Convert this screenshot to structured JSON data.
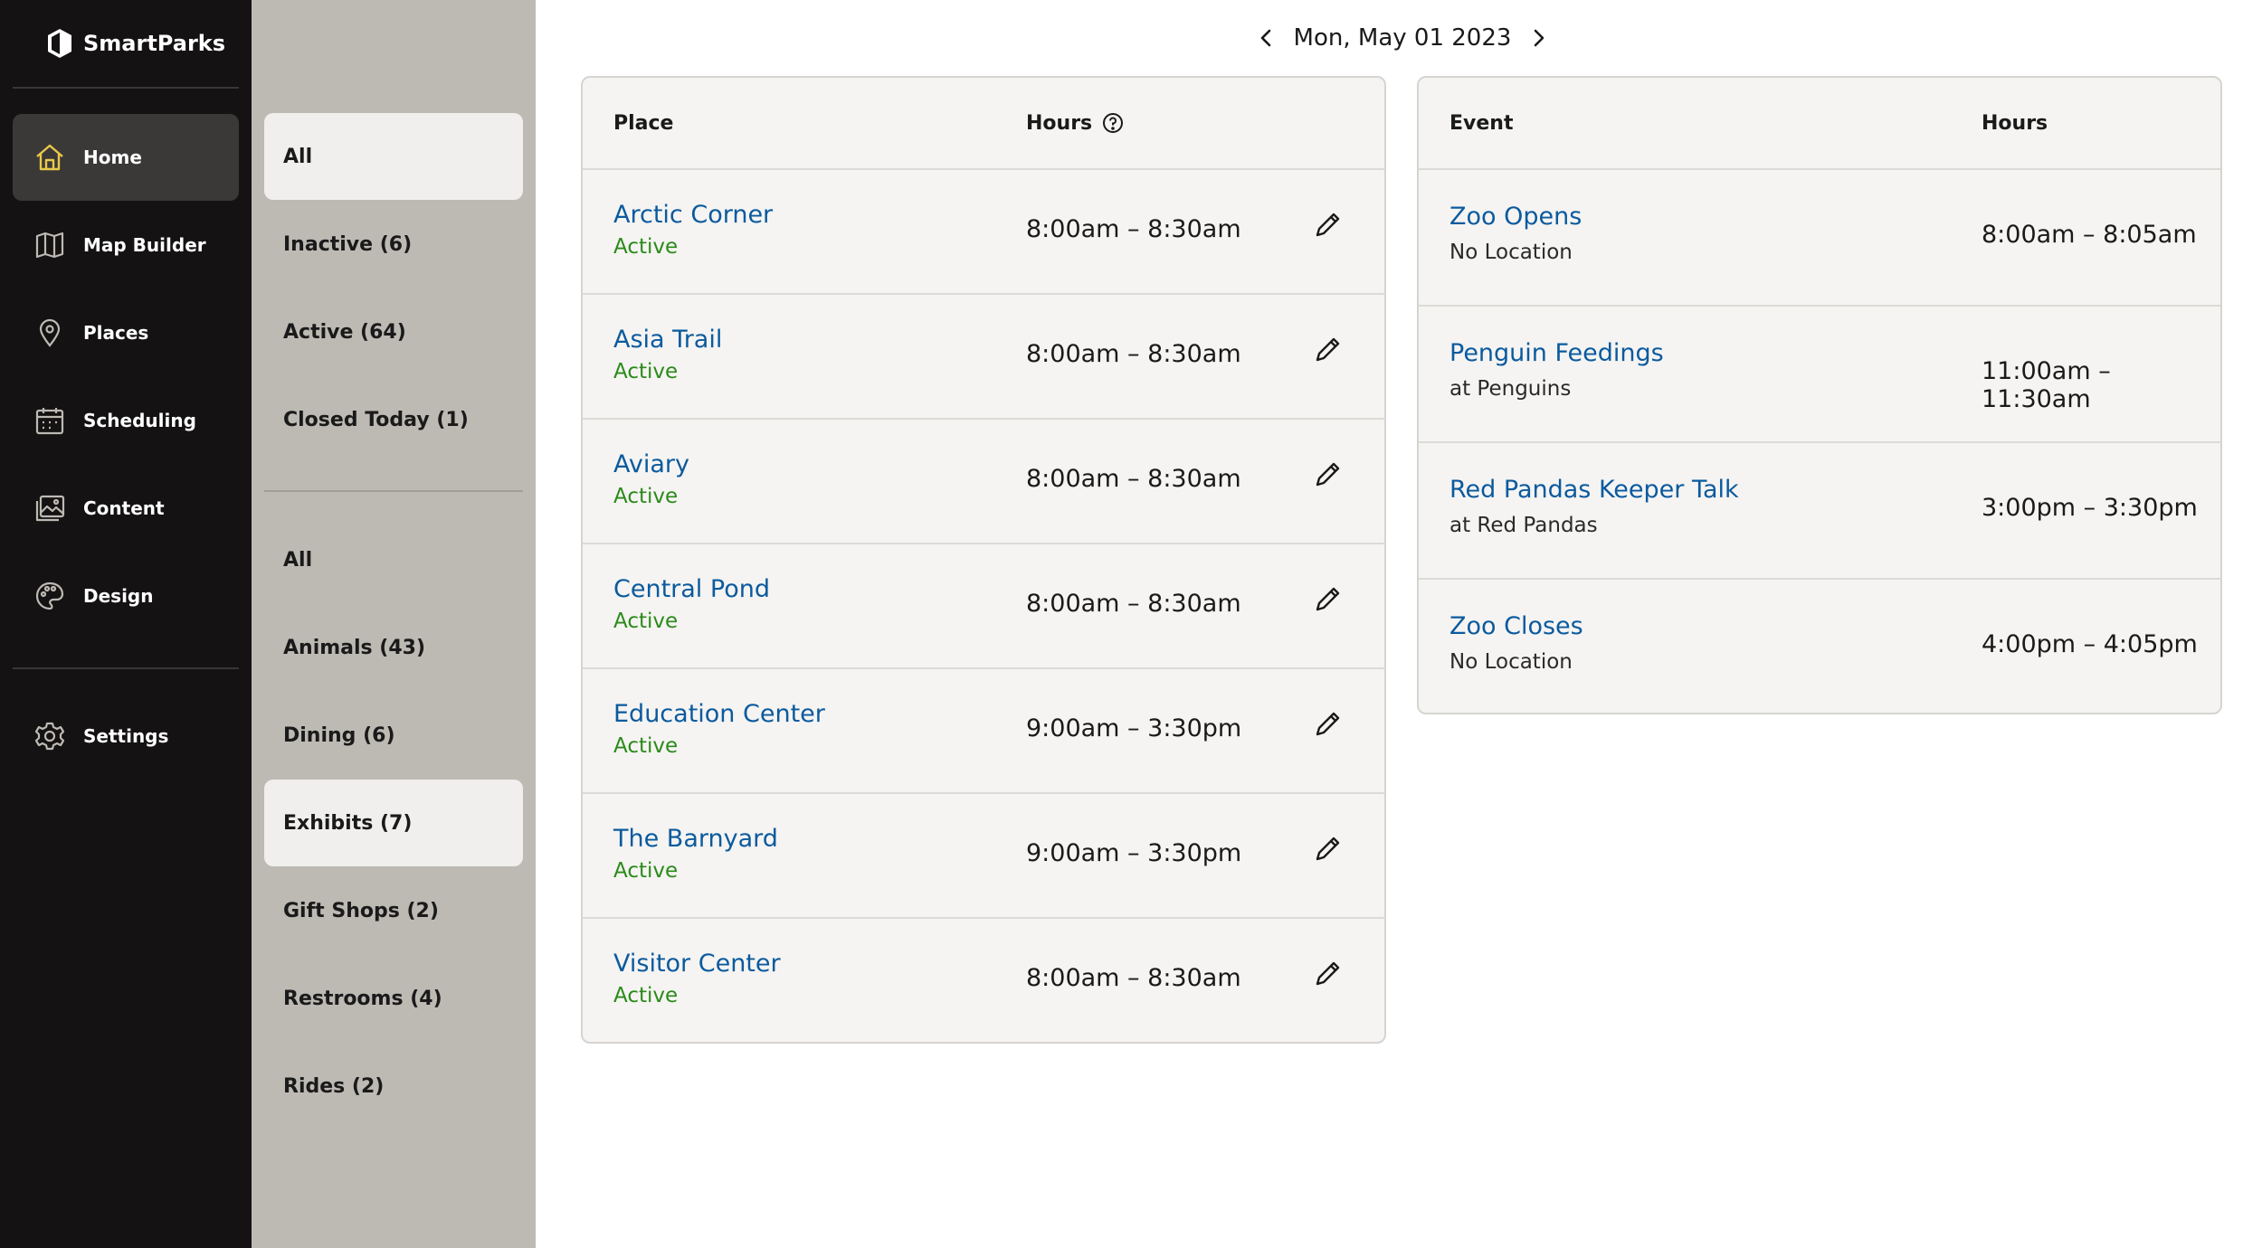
{
  "app": {
    "name": "SmartParks"
  },
  "nav": [
    {
      "label": "Home",
      "icon": "home-icon",
      "active": true
    },
    {
      "label": "Map Builder",
      "icon": "map-icon",
      "active": false
    },
    {
      "label": "Places",
      "icon": "location-pin-icon",
      "active": false
    },
    {
      "label": "Scheduling",
      "icon": "calendar-icon",
      "active": false
    },
    {
      "label": "Content",
      "icon": "image-gallery-icon",
      "active": false
    },
    {
      "label": "Design",
      "icon": "palette-icon",
      "active": false
    },
    {
      "label": "Settings",
      "icon": "gear-icon",
      "active": false
    }
  ],
  "filters": {
    "status": [
      {
        "label": "All",
        "selected": true
      },
      {
        "label": "Inactive (6)",
        "selected": false
      },
      {
        "label": "Active (64)",
        "selected": false
      },
      {
        "label": "Closed Today (1)",
        "selected": false
      }
    ],
    "categories": [
      {
        "label": "All",
        "selected": false
      },
      {
        "label": "Animals (43)",
        "selected": false
      },
      {
        "label": "Dining (6)",
        "selected": false
      },
      {
        "label": "Exhibits (7)",
        "selected": true
      },
      {
        "label": "Gift Shops (2)",
        "selected": false
      },
      {
        "label": "Restrooms (4)",
        "selected": false
      },
      {
        "label": "Rides (2)",
        "selected": false
      }
    ]
  },
  "date": {
    "label": "Mon, May 01 2023"
  },
  "places_table": {
    "col_place": "Place",
    "col_hours": "Hours",
    "rows": [
      {
        "name": "Arctic Corner",
        "status": "Active",
        "hours": "8:00am – 8:30am"
      },
      {
        "name": "Asia Trail",
        "status": "Active",
        "hours": "8:00am – 8:30am"
      },
      {
        "name": "Aviary",
        "status": "Active",
        "hours": "8:00am – 8:30am"
      },
      {
        "name": "Central Pond",
        "status": "Active",
        "hours": "8:00am – 8:30am"
      },
      {
        "name": "Education Center",
        "status": "Active",
        "hours": "9:00am – 3:30pm"
      },
      {
        "name": "The Barnyard",
        "status": "Active",
        "hours": "9:00am – 3:30pm"
      },
      {
        "name": "Visitor Center",
        "status": "Active",
        "hours": "8:00am – 8:30am"
      }
    ]
  },
  "events_table": {
    "col_event": "Event",
    "col_hours": "Hours",
    "rows": [
      {
        "name": "Zoo Opens",
        "location": "No Location",
        "hours": "8:00am – 8:05am"
      },
      {
        "name": "Penguin Feedings",
        "location": "at Penguins",
        "hours": "11:00am – 11:30am"
      },
      {
        "name": "Red Pandas Keeper Talk",
        "location": "at Red Pandas",
        "hours": "3:00pm – 3:30pm"
      },
      {
        "name": "Zoo Closes",
        "location": "No Location",
        "hours": "4:00pm – 4:05pm"
      }
    ]
  },
  "colors": {
    "sidebar_bg": "#141212",
    "filter_bg": "#bdbab4",
    "link": "#0b5a9e",
    "status_active": "#2b8a1a",
    "home_icon": "#e8c94a"
  }
}
